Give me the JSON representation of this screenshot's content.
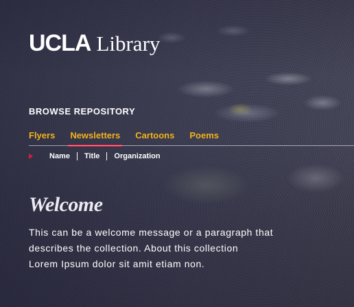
{
  "logo": {
    "brand": "UCLA",
    "name": "Library"
  },
  "browse_heading": "BROWSE REPOSITORY",
  "tabs": [
    {
      "label": "Flyers",
      "active": false
    },
    {
      "label": "Newsletters",
      "active": true
    },
    {
      "label": "Cartoons",
      "active": false
    },
    {
      "label": "Poems",
      "active": false
    }
  ],
  "sort": {
    "items": [
      "Name",
      "Title",
      "Organization"
    ]
  },
  "welcome": {
    "title": "Welcome",
    "lines": [
      "This can be a welcome message or a paragraph that",
      "describes the collection. About this collection",
      "Lorem Ipsum dolor sit amit etiam non."
    ]
  },
  "colors": {
    "tab_text": "#f2b31a",
    "active_underline": "#d81b3c",
    "text": "#ffffff"
  }
}
